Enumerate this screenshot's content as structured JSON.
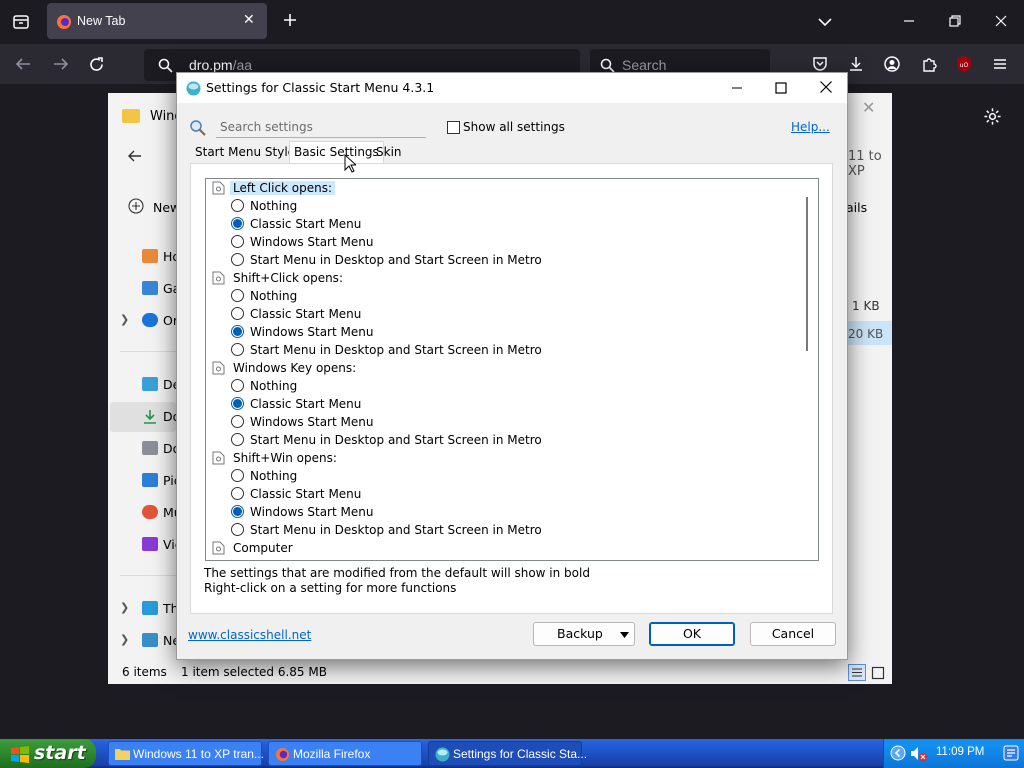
{
  "browser": {
    "tab_title": "New Tab",
    "url_host": "dro.pm",
    "url_path": "/aa",
    "search_placeholder": "Search"
  },
  "explorer": {
    "title": "Wind",
    "right_title": "11 to XP",
    "new_label": "New",
    "details_label": "ails",
    "size1": "1 KB",
    "size2": "20 KB",
    "nav_items": [
      "Ho",
      "Ga",
      "Or",
      "De",
      "Do",
      "Do",
      "Pic",
      "Mu",
      "Vic",
      "Th",
      "Ne"
    ],
    "status_items": "6 items",
    "status_selected": "1 item selected  6.85 MB"
  },
  "dialog": {
    "title": "Settings for Classic Start Menu 4.3.1",
    "search_placeholder": "Search settings",
    "show_all_label": "Show all settings",
    "help_link": "Help...",
    "tabs": [
      "Start Menu Style",
      "Basic Settings",
      "Skin"
    ],
    "active_tab": "Basic Settings",
    "groups": [
      {
        "label": "Left Click opens:",
        "selected": true,
        "options": [
          {
            "label": "Nothing",
            "checked": false
          },
          {
            "label": "Classic Start Menu",
            "checked": true
          },
          {
            "label": "Windows Start Menu",
            "checked": false
          },
          {
            "label": "Start Menu in Desktop and Start Screen in Metro",
            "checked": false
          }
        ]
      },
      {
        "label": "Shift+Click opens:",
        "selected": false,
        "options": [
          {
            "label": "Nothing",
            "checked": false
          },
          {
            "label": "Classic Start Menu",
            "checked": false
          },
          {
            "label": "Windows Start Menu",
            "checked": true
          },
          {
            "label": "Start Menu in Desktop and Start Screen in Metro",
            "checked": false
          }
        ]
      },
      {
        "label": "Windows Key opens:",
        "selected": false,
        "options": [
          {
            "label": "Nothing",
            "checked": false
          },
          {
            "label": "Classic Start Menu",
            "checked": true
          },
          {
            "label": "Windows Start Menu",
            "checked": false
          },
          {
            "label": "Start Menu in Desktop and Start Screen in Metro",
            "checked": false
          }
        ]
      },
      {
        "label": "Shift+Win opens:",
        "selected": false,
        "options": [
          {
            "label": "Nothing",
            "checked": false
          },
          {
            "label": "Classic Start Menu",
            "checked": false
          },
          {
            "label": "Windows Start Menu",
            "checked": true
          },
          {
            "label": "Start Menu in Desktop and Start Screen in Metro",
            "checked": false
          }
        ]
      },
      {
        "label": "Computer",
        "selected": false,
        "options": []
      }
    ],
    "hint_line1": "The settings that are modified from the default will show in bold",
    "hint_line2": "Right-click on a setting for more functions",
    "site_link": "www.classicshell.net",
    "backup_label": "Backup",
    "ok_label": "OK",
    "cancel_label": "Cancel"
  },
  "taskbar": {
    "start_label": "start",
    "buttons": [
      "Windows 11 to XP tran...",
      "Mozilla Firefox",
      "Settings for Classic Sta..."
    ],
    "clock": "11:09 PM"
  },
  "colors": {
    "firefox_dark": "#1c1b22",
    "firefox_toolbar": "#2b2a33",
    "radio_checked": "#005fb8",
    "link": "#0066cc",
    "xp_taskbar": "#245edb",
    "xp_start_green": "#2f8d2f"
  }
}
